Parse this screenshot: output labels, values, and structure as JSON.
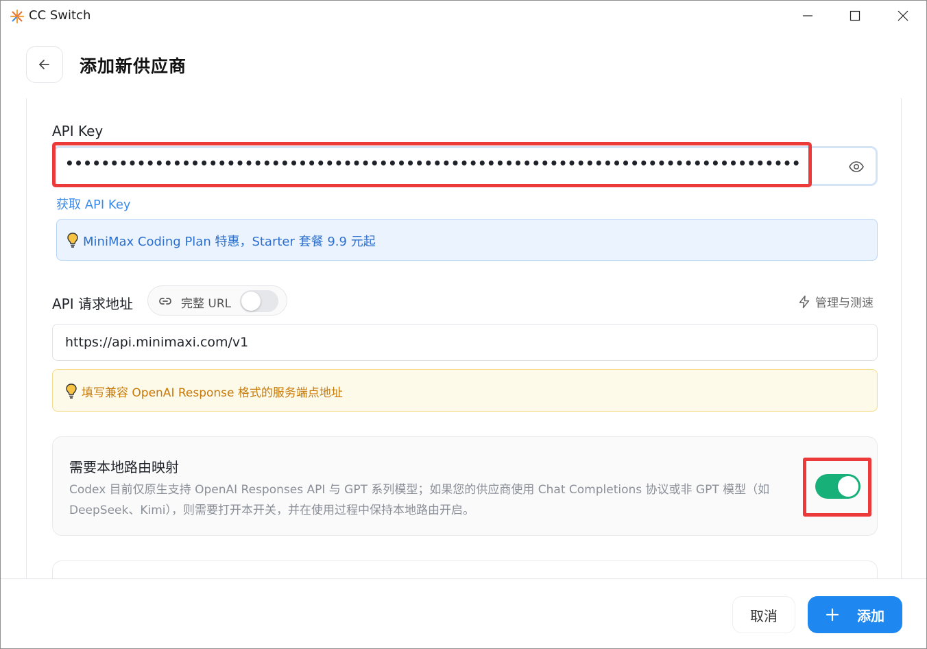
{
  "window": {
    "title": "CC Switch",
    "icon": "sunburst-logo-icon"
  },
  "header": {
    "title": "添加新供应商",
    "back_icon": "arrow-left-icon"
  },
  "api_key": {
    "label": "API Key",
    "value": "•••••••••••••••••••••••••••••••••••••••••••••••••••••••••••••••••••••••••••••••••••••••••••••••••••••••••••••",
    "get_link": "获取 API Key",
    "tip": "MiniMax Coding Plan 特惠，Starter 套餐 9.9 元起"
  },
  "endpoint": {
    "label": "API 请求地址",
    "full_url_toggle_label": "完整 URL",
    "full_url_enabled": false,
    "manage_link": "管理与测速",
    "value": "https://api.minimaxi.com/v1",
    "tip": "填写兼容 OpenAI Response 格式的服务端点地址"
  },
  "local_routing": {
    "title": "需要本地路由映射",
    "description": "Codex 目前仅原生支持 OpenAI Responses API 与 GPT 系列模型；如果您的供应商使用 Chat Completions 协议或非 GPT 模型（如 DeepSeek、Kimi），则需要打开本开关，并在使用过程中保持本地路由开启。",
    "enabled": true
  },
  "footer": {
    "cancel_label": "取消",
    "add_label": "添加"
  },
  "colors": {
    "accent": "#1e88f0",
    "toggle_on": "#17b079",
    "highlight_red": "#ec3a3a",
    "tip_blue_text": "#2b6fcf",
    "tip_yellow_text": "#c77a0a"
  }
}
